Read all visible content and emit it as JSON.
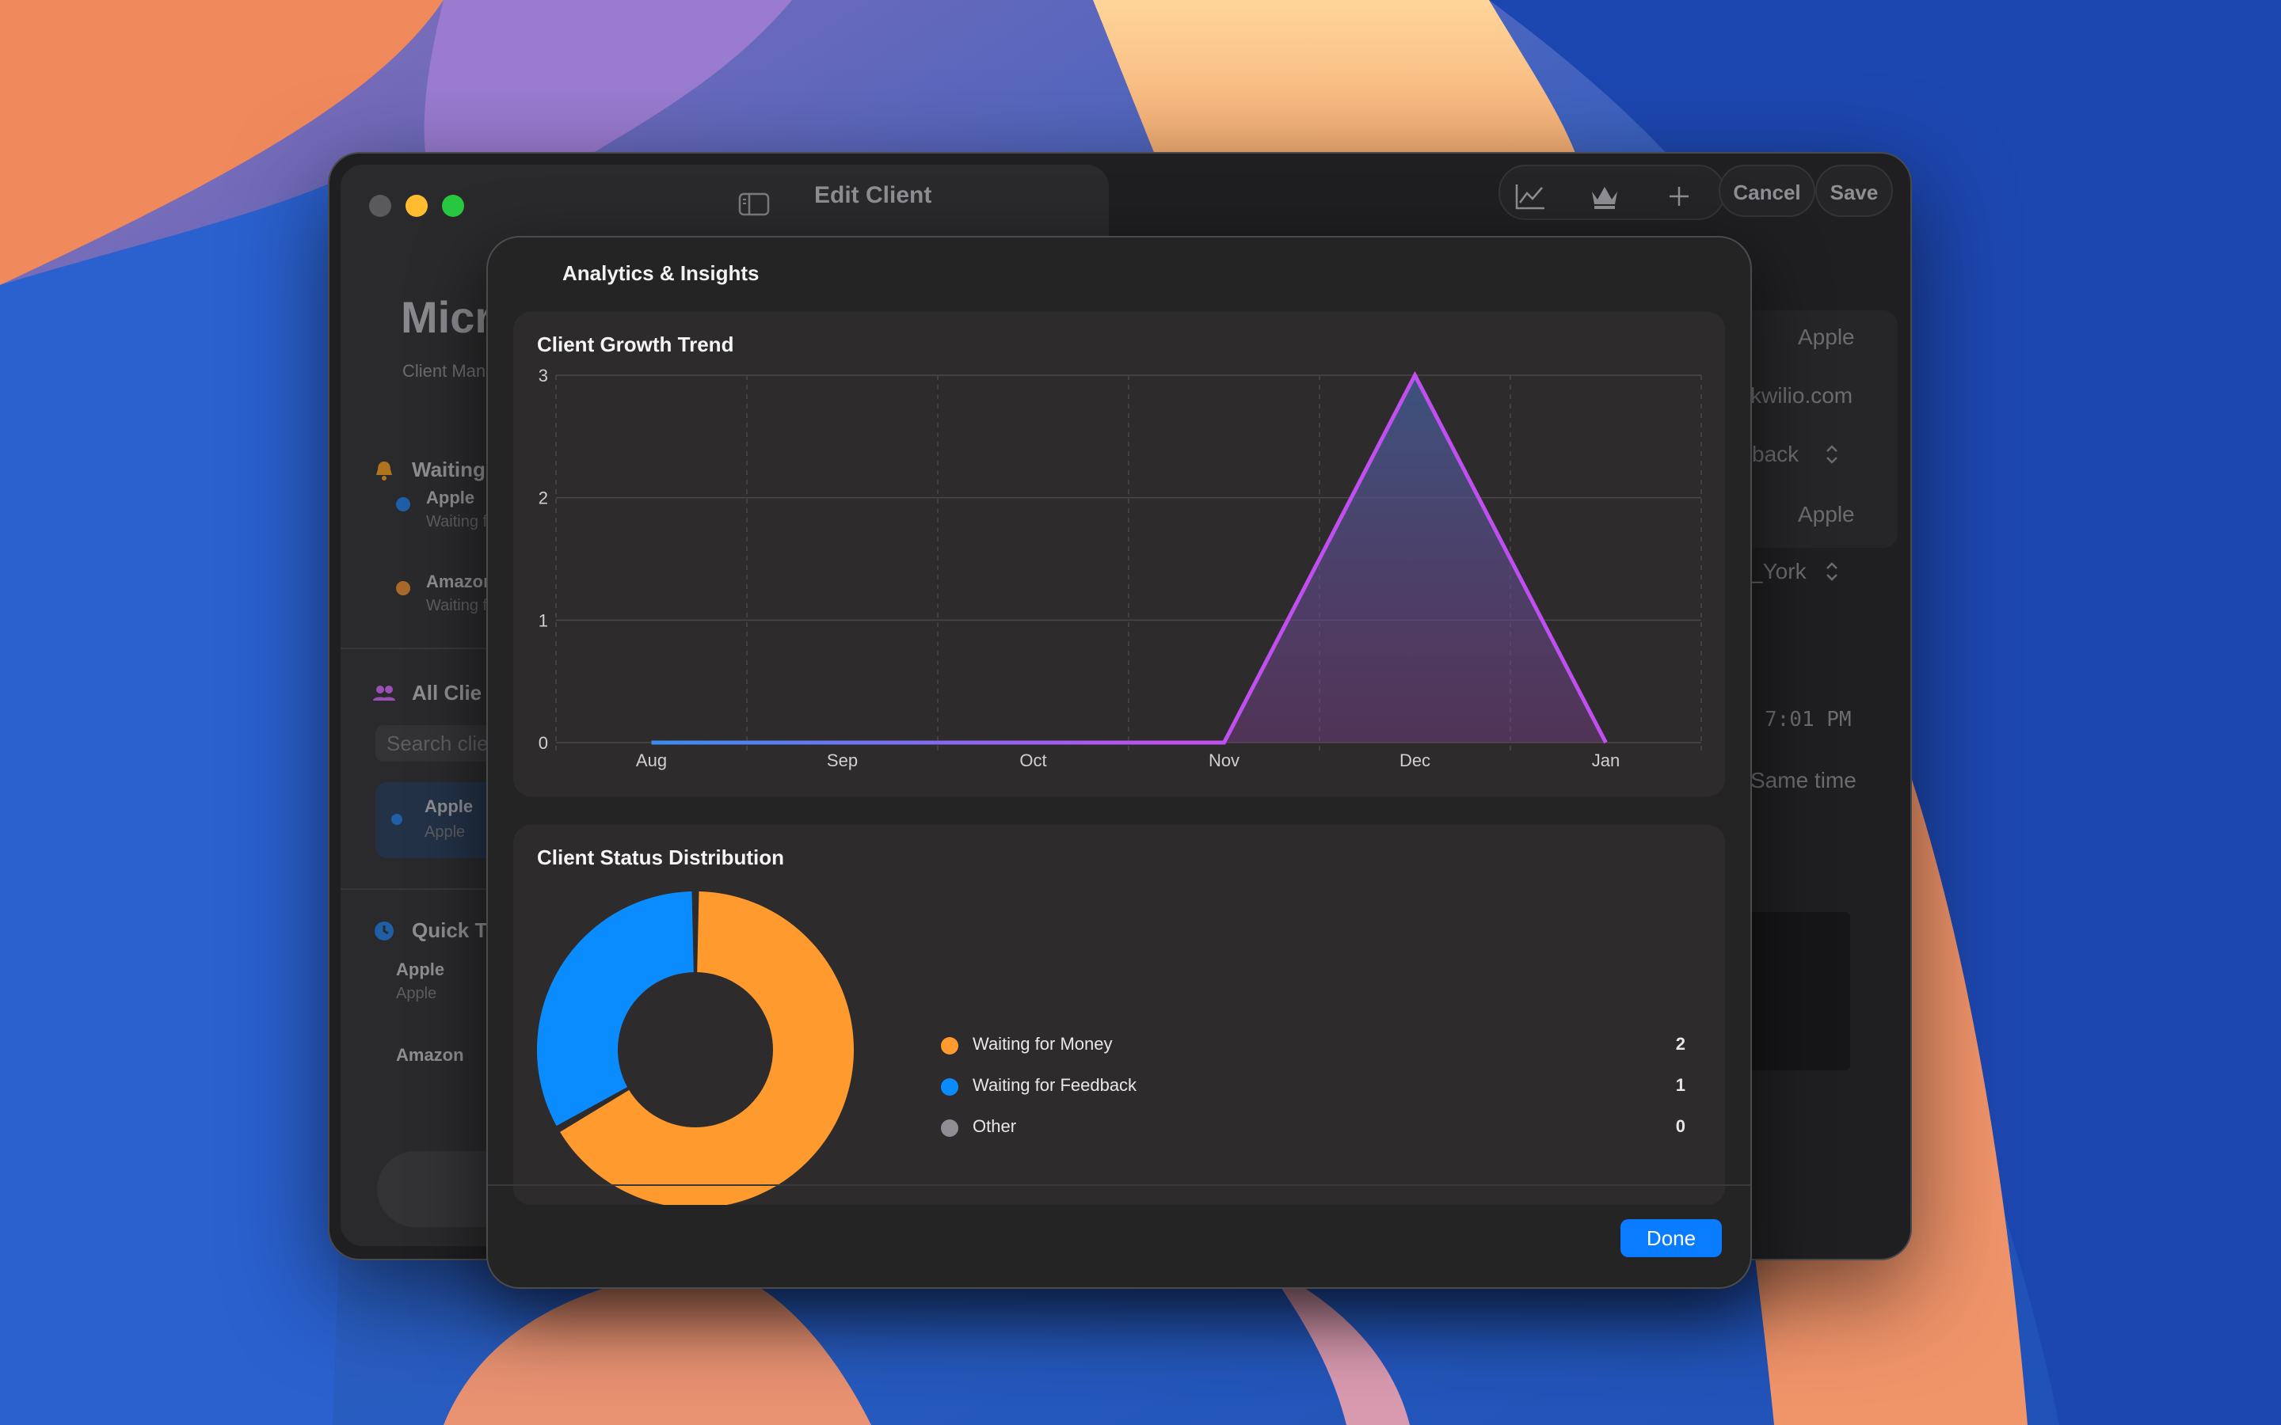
{
  "sidebar": {
    "app_title": "Micro",
    "app_subtitle": "Client Mana",
    "waiting_section": "Waiting",
    "waiting_items": [
      {
        "title": "Apple",
        "subtitle": "Waiting f",
        "color": "#1e5fa8"
      },
      {
        "title": "Amazon",
        "subtitle": "Waiting f",
        "color": "#a8692a"
      }
    ],
    "all_clients_section": "All Clie",
    "search_placeholder": "Search clie",
    "selected_client": {
      "title": "Apple",
      "subtitle": "Apple"
    },
    "quick_section": "Quick Ti",
    "quick_items": [
      {
        "title": "Apple",
        "subtitle": "Apple"
      },
      {
        "title": "Amazon",
        "subtitle": ""
      }
    ]
  },
  "toolbar": {
    "title": "Edit Client",
    "cancel_label": "Cancel",
    "save_label": "Save",
    "icons": [
      "chart-icon",
      "crown-icon",
      "plus-icon"
    ]
  },
  "form_partial": {
    "company": "Apple",
    "email": "kwilio.com",
    "status": "back",
    "contact": "Apple",
    "timezone": "_York",
    "time": "7:01 PM",
    "repeat": "Same time"
  },
  "sheet": {
    "title": "Analytics & Insights",
    "done_label": "Done"
  },
  "growth_chart": {
    "title": "Client Growth Trend",
    "chart_data": {
      "type": "area",
      "categories": [
        "Aug",
        "Sep",
        "Oct",
        "Nov",
        "Dec",
        "Jan"
      ],
      "values": [
        0,
        0,
        0,
        0,
        3,
        0
      ],
      "ylim": [
        0,
        3
      ],
      "yticks": [
        0,
        1,
        2,
        3
      ],
      "grid": true,
      "colors": {
        "line_start": "#3b8cf0",
        "line_end": "#c04ff0"
      }
    }
  },
  "status_chart": {
    "title": "Client Status Distribution",
    "chart_data": {
      "type": "pie",
      "categories": [
        "Waiting for Money",
        "Waiting for Feedback",
        "Other"
      ],
      "values": [
        2,
        1,
        0
      ],
      "colors": [
        "#ff9a2e",
        "#0a8cff",
        "#8e8e93"
      ]
    }
  }
}
